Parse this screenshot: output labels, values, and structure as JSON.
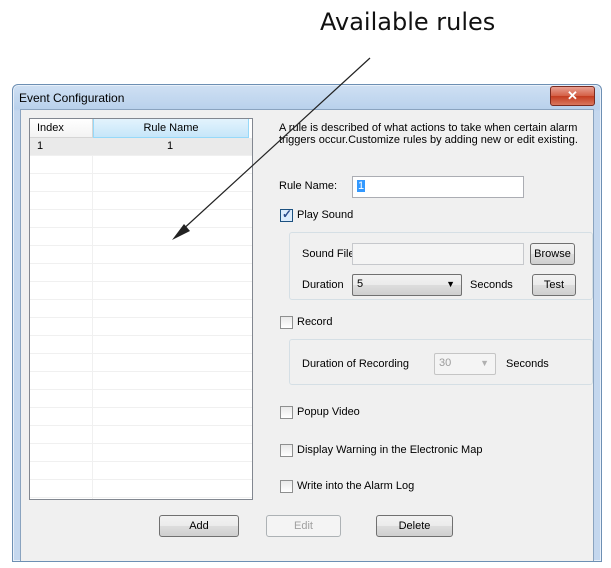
{
  "annotation": {
    "callout": "Available rules"
  },
  "window": {
    "title": "Event Configuration",
    "close_glyph": "✕"
  },
  "rule_list": {
    "columns": [
      "Index",
      "Rule Name"
    ],
    "rows": [
      {
        "index": "1",
        "name": "1"
      }
    ]
  },
  "panel": {
    "description": "A rule is described of what actions to take when certain alarm triggers occur.Customize rules by adding new or edit existing.",
    "rule_name_label": "Rule Name:",
    "rule_name_value": "1",
    "play_sound": {
      "label": "Play Sound",
      "checked": true
    },
    "sound_file_label": "Sound File",
    "sound_file_value": "",
    "browse_label": "Browse",
    "duration_label": "Duration",
    "duration_value": "5",
    "duration_unit": "Seconds",
    "test_label": "Test",
    "record": {
      "label": "Record",
      "checked": false
    },
    "recording_duration_label": "Duration of  Recording",
    "recording_duration_value": "30",
    "recording_unit": "Seconds",
    "popup_video": {
      "label": "Popup Video",
      "checked": false
    },
    "display_warning": {
      "label": "Display Warning in the Electronic Map",
      "checked": false
    },
    "write_log": {
      "label": "Write into the Alarm Log",
      "checked": false
    }
  },
  "buttons": {
    "add": "Add",
    "edit": "Edit",
    "delete": "Delete"
  }
}
